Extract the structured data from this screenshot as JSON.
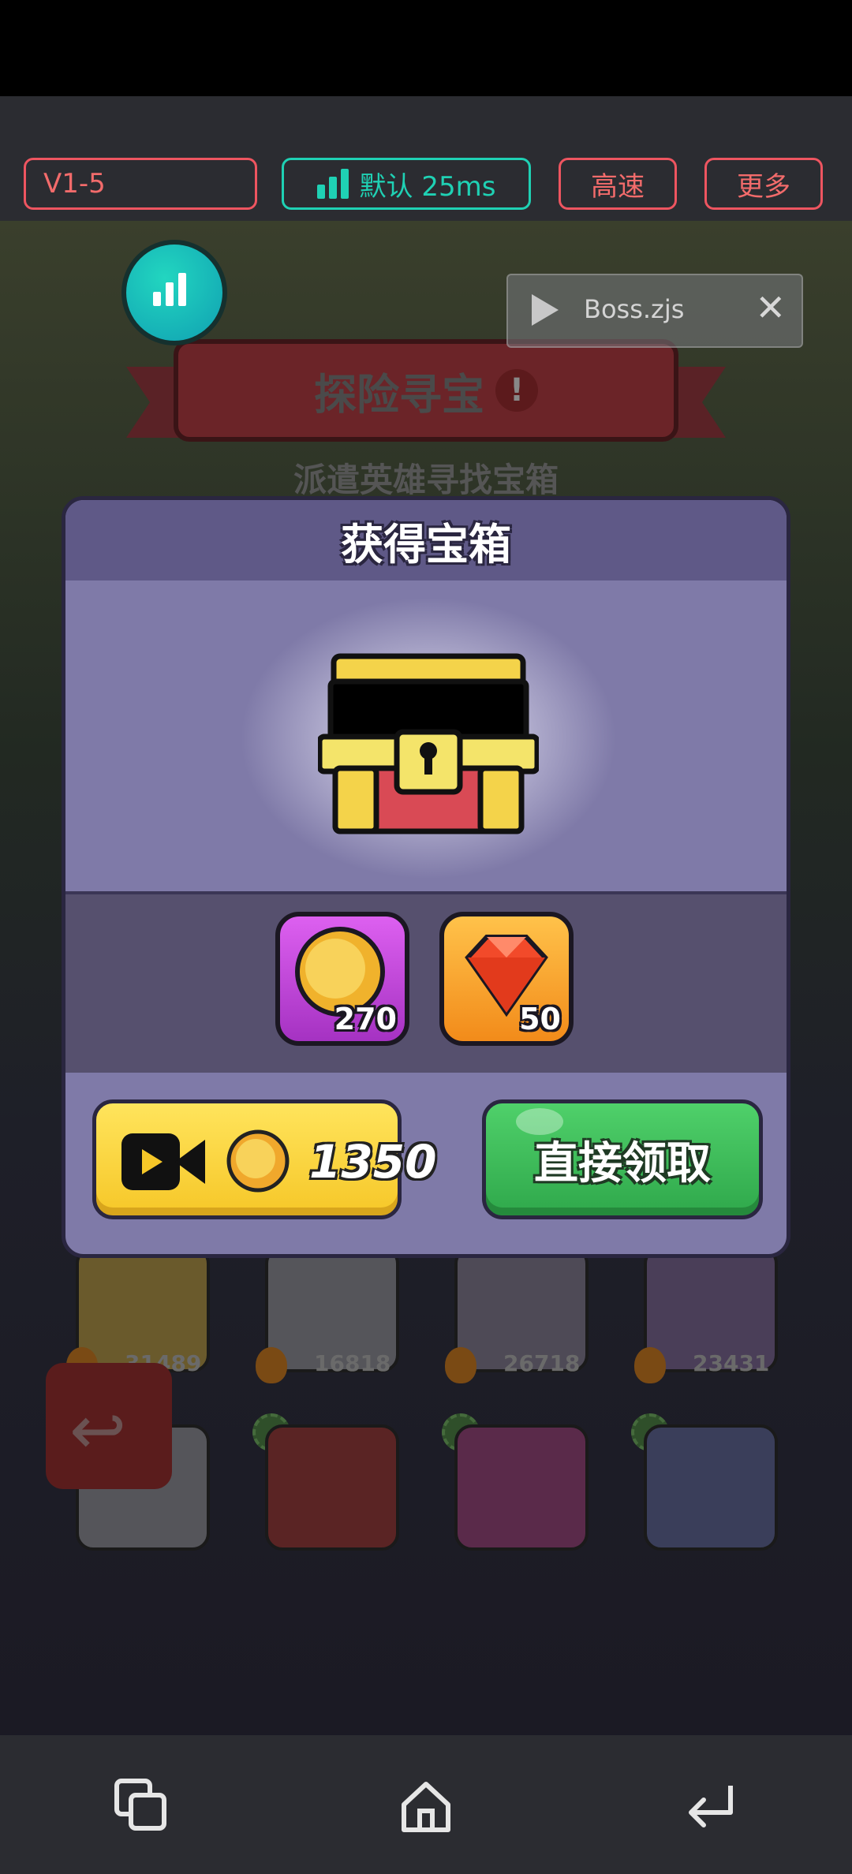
{
  "toolbar": {
    "version": "V1-5",
    "speed_mode": "默认 25ms",
    "fast_button": "高速",
    "more_button": "更多"
  },
  "floating": {
    "stats_icon": "bar-chart-icon",
    "script_name": "Boss.zjs"
  },
  "game": {
    "banner_title": "探险寻宝",
    "banner_badge": "!",
    "subtitle": "派遣英雄寻找宝箱",
    "hero_power": [
      "31489",
      "16818",
      "26718",
      "23431"
    ],
    "back_icon": "back-arrow-icon"
  },
  "modal": {
    "title": "获得宝箱",
    "rewards": [
      {
        "icon": "gold-coin-icon",
        "qty": "270"
      },
      {
        "icon": "red-gem-icon",
        "qty": "50"
      }
    ],
    "ad_button_amount": "1350",
    "claim_button": "直接领取"
  },
  "colors": {
    "accent_red": "#ee5560",
    "accent_teal": "#1fd1b4",
    "modal_bg": "#7f7aa8",
    "ad_button": "#f6c728",
    "claim_button": "#2fa84b"
  },
  "navbar": {
    "recent_icon": "recent-apps-icon",
    "home_icon": "home-icon",
    "back_icon": "back-icon"
  }
}
